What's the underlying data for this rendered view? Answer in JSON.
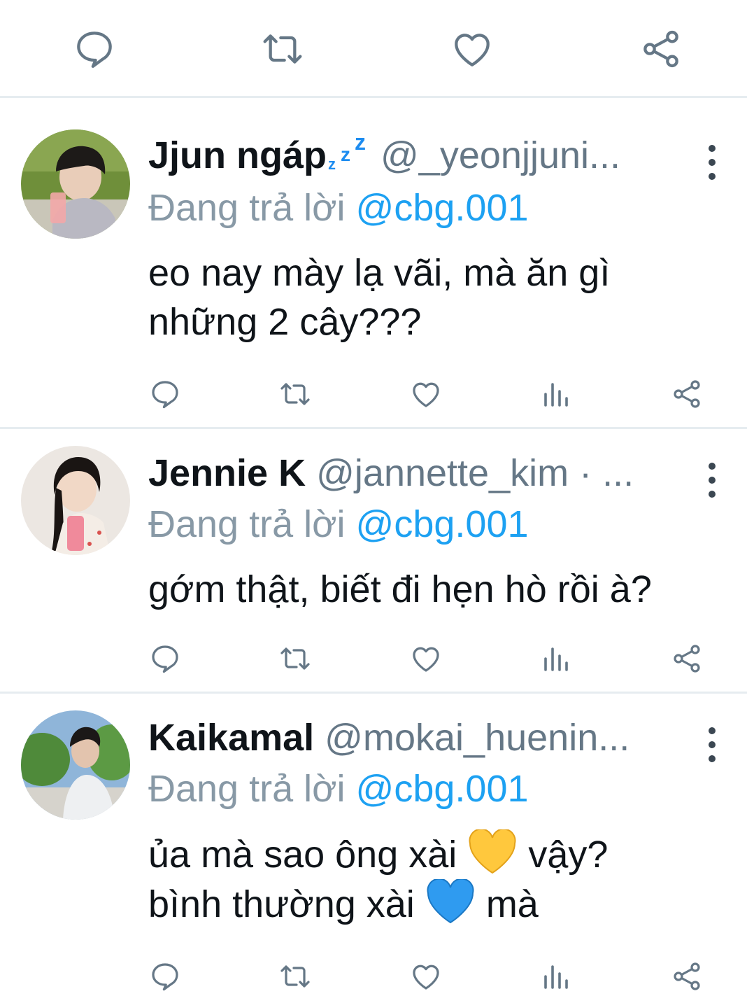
{
  "top_actions": {
    "icons": [
      "reply-icon",
      "retweet-icon",
      "like-icon",
      "share-icon"
    ],
    "color": "#657786"
  },
  "replies": [
    {
      "display_name": "Jjun ngáp",
      "name_emoji": "zzz",
      "handle": "@_yeonjjuni...",
      "replying_label": "Đang trả lời",
      "replying_to": "@cbg.001",
      "text_lines": [
        "eo nay mày lạ vãi, mà ăn gì",
        "những 2 cây???"
      ]
    },
    {
      "display_name": "Jennie K",
      "handle": "@jannette_kim · ...",
      "replying_label": "Đang trả lời",
      "replying_to": "@cbg.001",
      "text_lines": [
        "gớm thật, biết đi hẹn hò rồi à?"
      ]
    },
    {
      "display_name": "Kaikamal",
      "handle": "@mokai_huenin...",
      "replying_label": "Đang trả lời",
      "replying_to": "@cbg.001",
      "line1_before": "ủa mà sao ông xài",
      "line1_after": "vậy?",
      "line2_before": "bình thường xài",
      "line2_after": "mà",
      "emoji_1": "yellow-heart",
      "emoji_2": "blue-heart"
    }
  ],
  "colors": {
    "mention": "#1da1f2",
    "muted": "#8899a6",
    "divider": "#e6ecf0",
    "icon": "#657786"
  }
}
